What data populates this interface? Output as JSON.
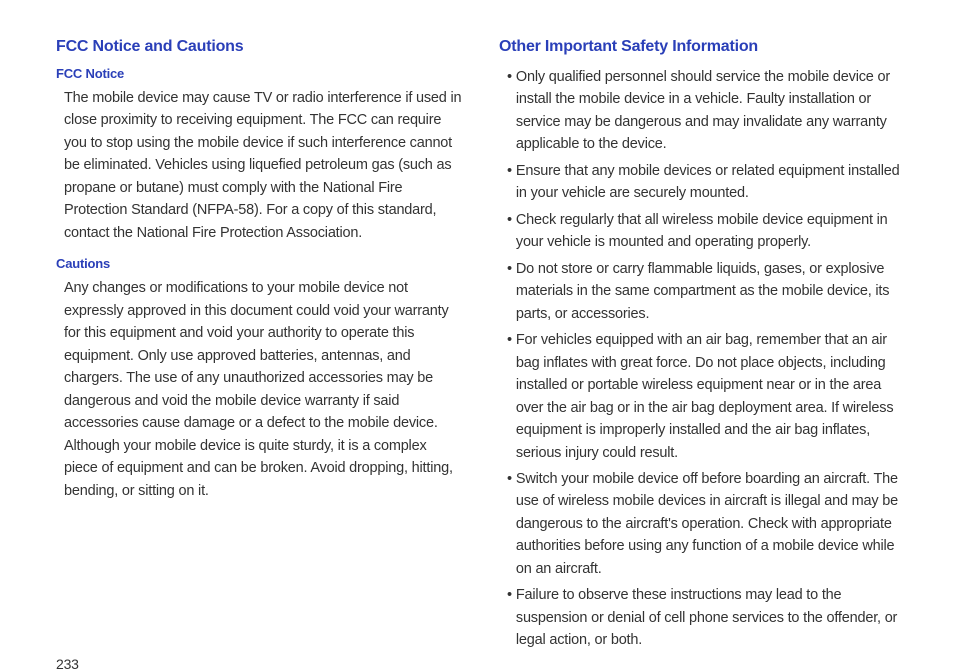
{
  "left": {
    "heading": "FCC Notice and Cautions",
    "section1": {
      "title": "FCC Notice",
      "body": "The mobile device may cause TV or radio interference if used in close proximity to receiving equipment. The FCC can require you to stop using the mobile device if such interference cannot be eliminated. Vehicles using liquefied petroleum gas (such as propane or butane) must comply with the National Fire Protection Standard (NFPA-58). For a copy of this standard, contact the National Fire Protection Association."
    },
    "section2": {
      "title": "Cautions",
      "body": "Any changes or modifications to your mobile device not expressly approved in this document could void your warranty for this equipment and void your authority to operate this equipment. Only use approved batteries, antennas, and chargers. The use of any unauthorized accessories may be dangerous and void the mobile device warranty if said accessories cause damage or a defect to the mobile device. Although your mobile device is quite sturdy, it is a complex piece of equipment and can be broken. Avoid dropping, hitting, bending, or sitting on it."
    }
  },
  "right": {
    "heading": "Other Important Safety Information",
    "bullets": [
      "Only qualified personnel should service the mobile device or install the mobile device in a vehicle. Faulty installation or service may be dangerous and may invalidate any warranty applicable to the device.",
      "Ensure that any mobile devices or related equipment installed in your vehicle are securely mounted.",
      "Check regularly that all wireless mobile device equipment in your vehicle is mounted and operating properly.",
      "Do not store or carry flammable liquids, gases, or explosive materials in the same compartment as the mobile device, its parts, or accessories.",
      "For vehicles equipped with an air bag, remember that an air bag inflates with great force. Do not place objects, including installed or portable wireless equipment near or in the area over the air bag or in the air bag deployment area. If wireless equipment is improperly installed and the air bag inflates, serious injury could result.",
      "Switch your mobile device off before boarding an aircraft. The use of wireless mobile devices in aircraft is illegal and may be dangerous to the aircraft's operation. Check with appropriate authorities before using any function of a mobile device while on an aircraft.",
      "Failure to observe these instructions may lead to the suspension or denial of cell phone services to the offender, or legal action, or both."
    ]
  },
  "pageNumber": "233"
}
